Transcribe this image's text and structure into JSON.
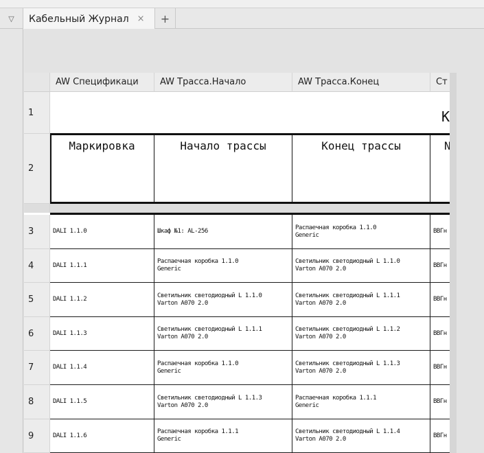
{
  "tabbar": {
    "tab_title": "Кабельный Журнал",
    "close_glyph": "×",
    "add_glyph": "+",
    "dropdown_glyph": "▽"
  },
  "table": {
    "column_headers": [
      "AW Спецификаци",
      "AW Трасса.Начало",
      "AW Трасса.Конец",
      "Ст"
    ],
    "row1_text": "К",
    "header_cells": [
      "Маркировка",
      "Начало трассы",
      "Конец трассы",
      "N"
    ],
    "row_numbers": [
      "1",
      "2",
      "3",
      "4",
      "5",
      "6",
      "7",
      "8",
      "9"
    ],
    "rows": [
      {
        "mark": "DALI 1.1.0",
        "start": [
          "Шкаф №1: AL-256",
          ""
        ],
        "end": [
          "Распаечная коробка  1.1.0",
          "Generic"
        ],
        "cable": "ВВГн"
      },
      {
        "mark": "DALI 1.1.1",
        "start": [
          "Распаечная коробка  1.1.0",
          "Generic"
        ],
        "end": [
          "Светильник светодиодный L 1.1.0",
          "Varton A070 2.0"
        ],
        "cable": "ВВГн"
      },
      {
        "mark": "DALI 1.1.2",
        "start": [
          "Светильник светодиодный L 1.1.0",
          "Varton A070 2.0"
        ],
        "end": [
          "Светильник светодиодный L 1.1.1",
          "Varton A070 2.0"
        ],
        "cable": "ВВГн"
      },
      {
        "mark": "DALI 1.1.3",
        "start": [
          "Светильник светодиодный L 1.1.1",
          "Varton A070 2.0"
        ],
        "end": [
          "Светильник светодиодный L 1.1.2",
          "Varton A070 2.0"
        ],
        "cable": "ВВГн"
      },
      {
        "mark": "DALI 1.1.4",
        "start": [
          "Распаечная коробка  1.1.0",
          "Generic"
        ],
        "end": [
          "Светильник светодиодный L 1.1.3",
          "Varton A070 2.0"
        ],
        "cable": "ВВГн"
      },
      {
        "mark": "DALI 1.1.5",
        "start": [
          "Светильник светодиодный L 1.1.3",
          "Varton A070 2.0"
        ],
        "end": [
          "Распаечная коробка  1.1.1",
          "Generic"
        ],
        "cable": "ВВГн"
      },
      {
        "mark": "DALI 1.1.6",
        "start": [
          "Распаечная коробка  1.1.1",
          "Generic"
        ],
        "end": [
          "Светильник светодиодный L 1.1.4",
          "Varton A070 2.0"
        ],
        "cable": "ВВГн"
      }
    ]
  }
}
